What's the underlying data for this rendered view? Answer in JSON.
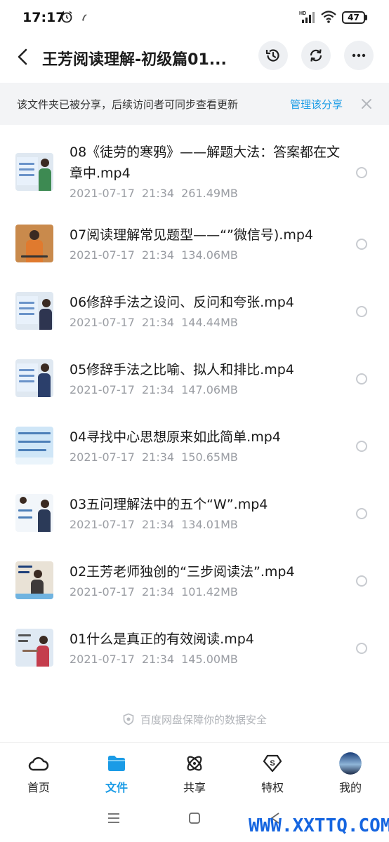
{
  "status_bar": {
    "time": "17:17",
    "battery": "47"
  },
  "header": {
    "title": "王芳阅读理解-初级篇01..."
  },
  "banner": {
    "text": "该文件夹已被分享，后续访问者可同步查看更新",
    "link": "管理该分享"
  },
  "files": [
    {
      "name": "08《徒劳的寒鸦》——解题大法：答案都在文章中.mp4",
      "date": "2021-07-17",
      "time": "21:34",
      "size": "261.49MB"
    },
    {
      "name": "07阅读理解常见题型——“”微信号).mp4",
      "date": "2021-07-17",
      "time": "21:34",
      "size": "134.06MB"
    },
    {
      "name": "06修辞手法之设问、反问和夸张.mp4",
      "date": "2021-07-17",
      "time": "21:34",
      "size": "144.44MB"
    },
    {
      "name": "05修辞手法之比喻、拟人和排比.mp4",
      "date": "2021-07-17",
      "time": "21:34",
      "size": "147.06MB"
    },
    {
      "name": "04寻找中心思想原来如此简单.mp4",
      "date": "2021-07-17",
      "time": "21:34",
      "size": "150.65MB"
    },
    {
      "name": "03五问理解法中的五个“W”.mp4",
      "date": "2021-07-17",
      "time": "21:34",
      "size": "134.01MB"
    },
    {
      "name": "02王芳老师独创的“三步阅读法”.mp4",
      "date": "2021-07-17",
      "time": "21:34",
      "size": "101.42MB"
    },
    {
      "name": "01什么是真正的有效阅读.mp4",
      "date": "2021-07-17",
      "time": "21:34",
      "size": "145.00MB"
    }
  ],
  "secure_note": "百度网盘保障你的数据安全",
  "nav": {
    "home": "首页",
    "files": "文件",
    "share": "共享",
    "privilege": "特权",
    "mine": "我的"
  },
  "watermark": "WWW.XXTTQ.COM",
  "colors": {
    "accent": "#1a9be6",
    "meta": "#9a9da3",
    "banner_bg": "#f3f4f6"
  }
}
